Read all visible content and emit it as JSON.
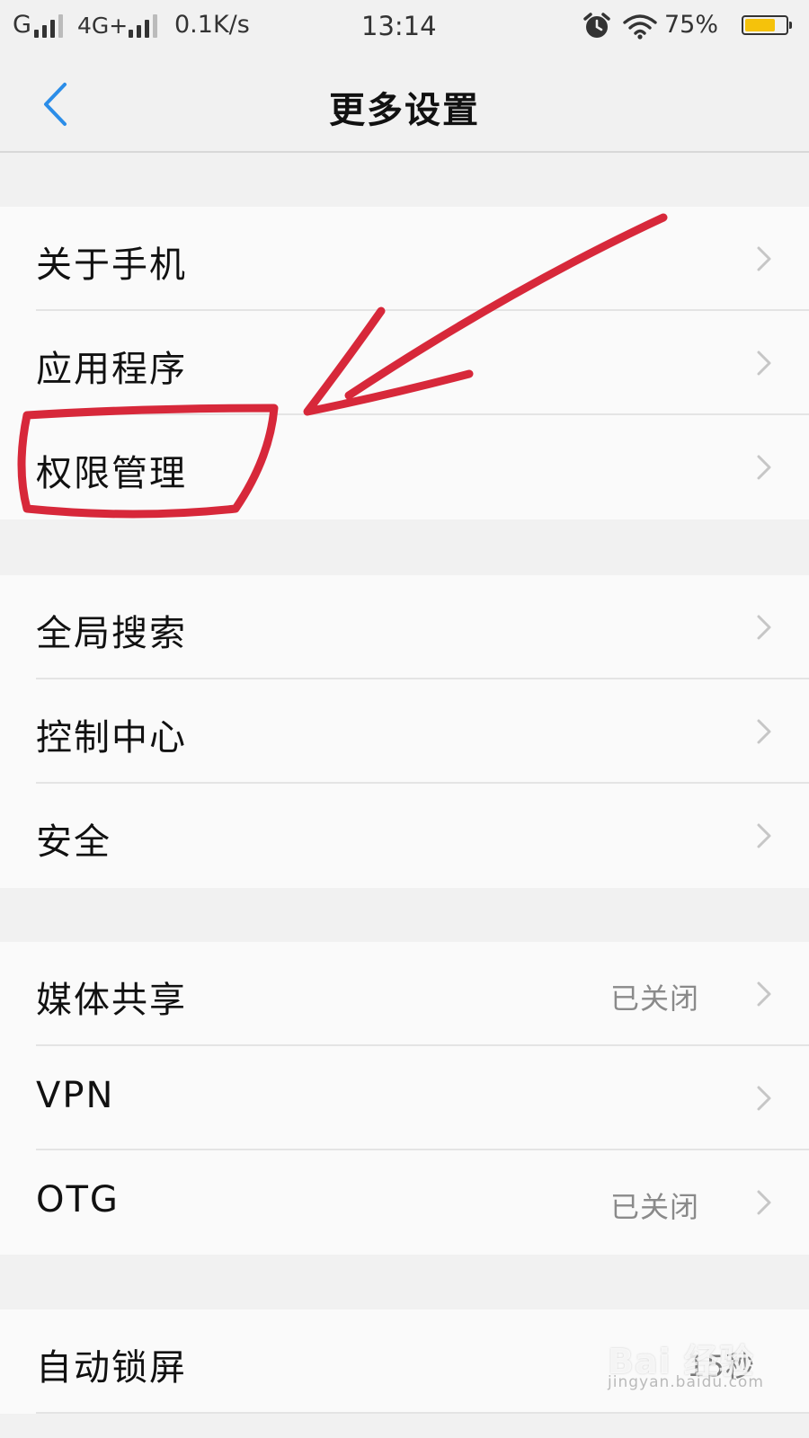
{
  "status_bar": {
    "carrier1": "G",
    "carrier2": "4G+",
    "net_speed": "0.1K/s",
    "time": "13:14",
    "battery_percent": "75%",
    "battery_level": 0.75,
    "battery_color": "#f5c20b",
    "icons": [
      "signal-icon",
      "alarm-clock-icon",
      "wifi-icon",
      "battery-icon"
    ]
  },
  "header": {
    "title": "更多设置",
    "back_icon": "chevron-left-icon",
    "accent_color": "#2b8de8"
  },
  "groups": [
    {
      "items": [
        {
          "label": "关于手机"
        },
        {
          "label": "应用程序"
        },
        {
          "label": "权限管理"
        }
      ]
    },
    {
      "items": [
        {
          "label": "全局搜索"
        },
        {
          "label": "控制中心"
        },
        {
          "label": "安全"
        }
      ]
    },
    {
      "items": [
        {
          "label": "媒体共享",
          "value": "已关闭"
        },
        {
          "label": "VPN"
        },
        {
          "label": "OTG",
          "value": "已关闭"
        }
      ]
    },
    {
      "items": [
        {
          "label": "自动锁屏",
          "value": "15秒"
        }
      ]
    }
  ],
  "annotation": {
    "color": "#d7283a"
  },
  "watermark": {
    "main": "Bai 经验",
    "sub": "jingyan.baidu.com"
  }
}
